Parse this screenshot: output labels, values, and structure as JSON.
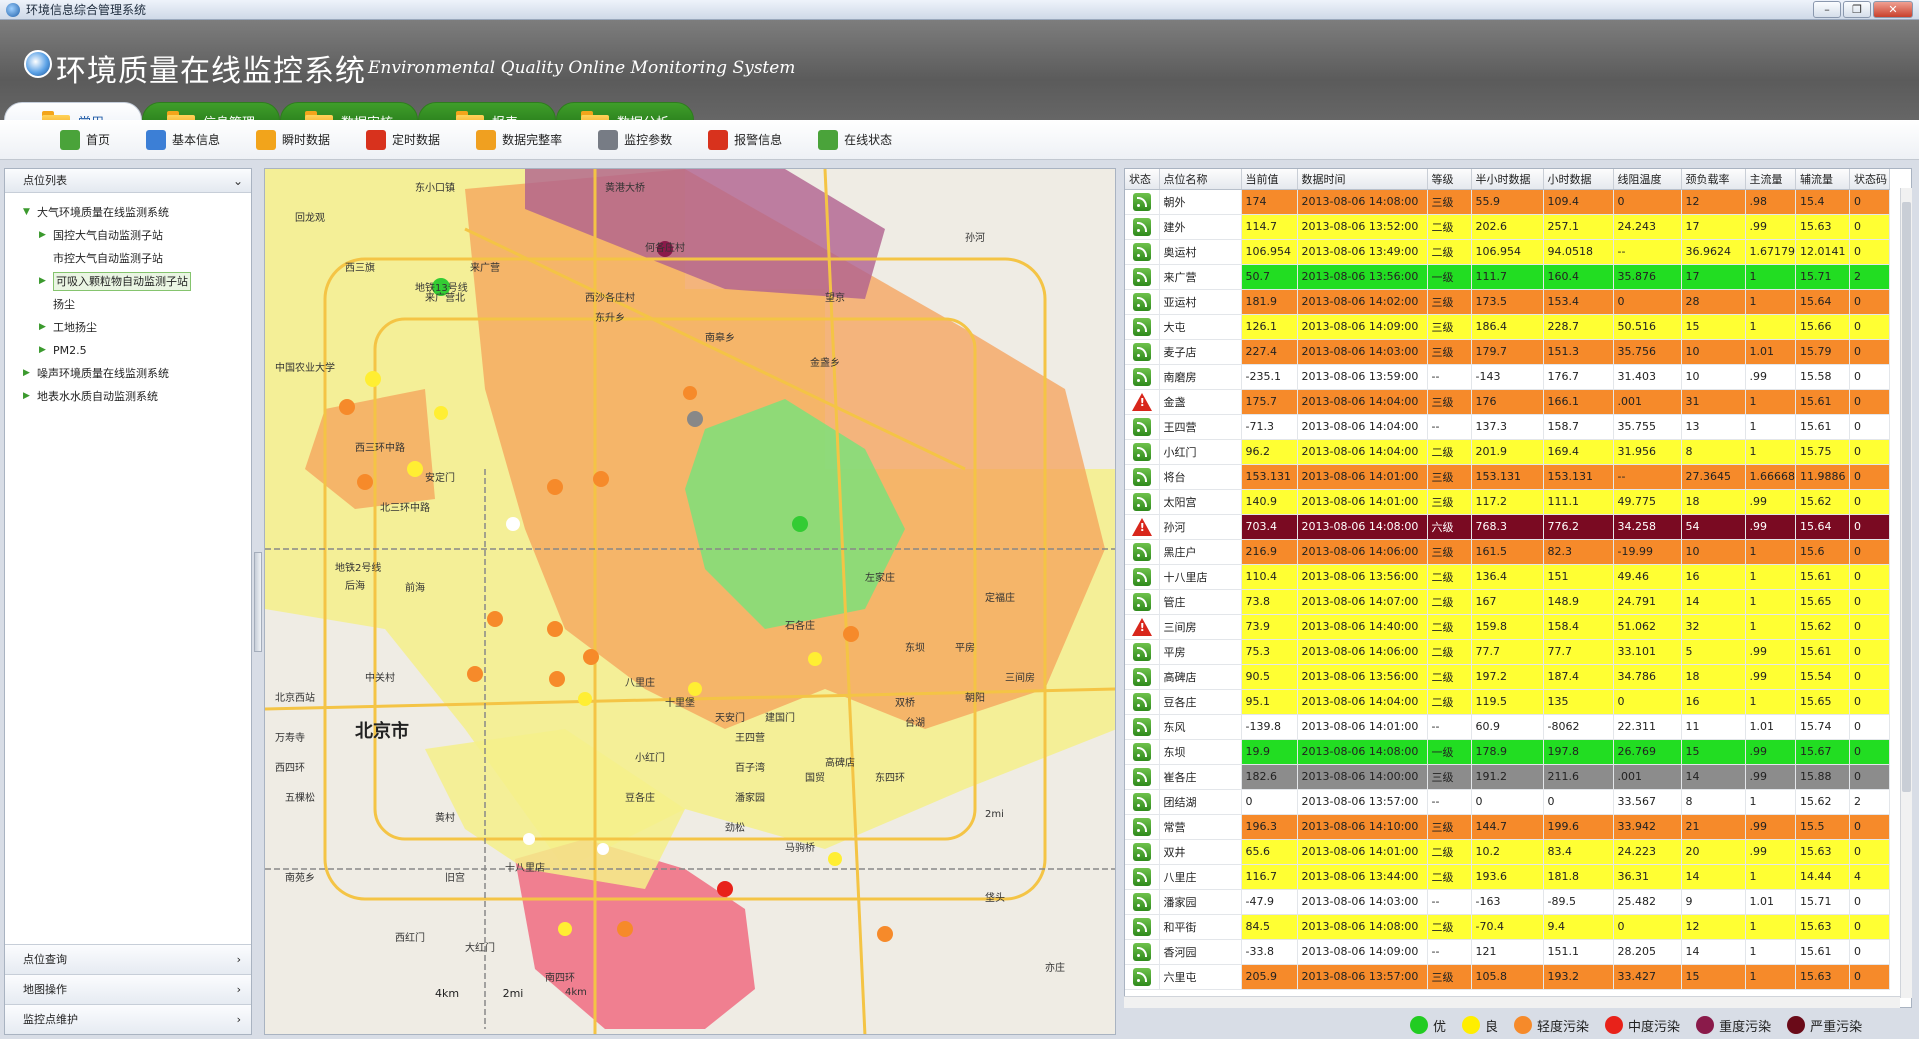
{
  "window": {
    "title": "环境信息综合管理系统",
    "buttons": [
      "–",
      "❐",
      "✕"
    ]
  },
  "header": {
    "title": "环境质量在线监控系统",
    "subtitle": "Environmental Quality Online Monitoring System"
  },
  "tabs": [
    {
      "label": "常用",
      "active": true
    },
    {
      "label": "信息管理"
    },
    {
      "label": "数据审核"
    },
    {
      "label": "报表"
    },
    {
      "label": "数据分析"
    }
  ],
  "toolbar": [
    {
      "label": "首页",
      "icon": "home-icon",
      "color": "#4aa33a"
    },
    {
      "label": "基本信息",
      "icon": "info-icon",
      "color": "#3c7fd6"
    },
    {
      "label": "瞬时数据",
      "icon": "lightning-icon",
      "color": "#f2a41b"
    },
    {
      "label": "定时数据",
      "icon": "clock-icon",
      "color": "#d8321d"
    },
    {
      "label": "数据完整率",
      "icon": "completeness-icon",
      "color": "#f0a020"
    },
    {
      "label": "监控参数",
      "icon": "params-icon",
      "color": "#777c85"
    },
    {
      "label": "报警信息",
      "icon": "phone-alarm-icon",
      "color": "#d8321d"
    },
    {
      "label": "在线状态",
      "icon": "speaker-icon",
      "color": "#4aa33a"
    }
  ],
  "left_panel": {
    "header": "点位列表",
    "tree": [
      {
        "label": "大气环境质量在线监测系统",
        "level": 0,
        "arrow": "▼"
      },
      {
        "label": "国控大气自动监测子站",
        "level": 1,
        "arrow": "▶"
      },
      {
        "label": "市控大气自动监测子站",
        "level": 1,
        "arrow": ""
      },
      {
        "label": "可吸入颗粒物自动监测子站",
        "level": 1,
        "arrow": "▶",
        "selected": true
      },
      {
        "label": "扬尘",
        "level": 1,
        "arrow": ""
      },
      {
        "label": "工地扬尘",
        "level": 1,
        "arrow": "▶"
      },
      {
        "label": "PM2.5",
        "level": 1,
        "arrow": "▶"
      },
      {
        "label": "噪声环境质量在线监测系统",
        "level": 0,
        "arrow": "▶"
      },
      {
        "label": "地表水水质自动监测系统",
        "level": 0,
        "arrow": "▶"
      }
    ],
    "bottom": [
      "点位查询",
      "地图操作",
      "监控点维护"
    ]
  },
  "map": {
    "city_label": "北京市",
    "labels": [
      "东小口镇",
      "黄港大桥",
      "西三旗",
      "回龙观",
      "何各庄村",
      "西沙各庄村",
      "来广营",
      "东升乡",
      "地铁13号线",
      "来广营北",
      "望京",
      "南皋乡",
      "金盏乡",
      "中国农业大学",
      "西三环中路",
      "北三环中路",
      "安定门",
      "地铁2号线",
      "后海",
      "前海",
      "北京西站",
      "万寿寺",
      "中关村",
      "孙河",
      "高碑店",
      "朝阳",
      "石各庄",
      "八里庄",
      "十里堡",
      "王四营",
      "百子湾",
      "潘家园",
      "劲松",
      "国贸",
      "东四环",
      "五棵松",
      "西四环",
      "建国门",
      "天安门",
      "左家庄",
      "东坝",
      "平房",
      "定福庄",
      "三间房",
      "双桥",
      "豆各庄",
      "小红门",
      "大红门",
      "南四环",
      "4km",
      "2mi",
      "亦庄",
      "台湖",
      "垡头",
      "马驹桥",
      "十八里店",
      "旧宫",
      "西红门",
      "黄村",
      "南苑乡"
    ],
    "scale": {
      "km": "4km",
      "mi": "2mi"
    }
  },
  "grid": {
    "columns": [
      "状态",
      "点位名称",
      "当前值",
      "数据时间",
      "等级",
      "半小时数据",
      "小时数据",
      "线阻温度",
      "颈负载率",
      "主流量",
      "辅流量",
      "状态码"
    ],
    "rows": [
      {
        "status": "ok",
        "name": "朝外",
        "cur": "174",
        "time": "2013-08-06 14:08:00",
        "lvl": "三级",
        "half": "55.9",
        "hour": "109.4",
        "temp": "0",
        "load": "12",
        "main": ".98",
        "aux": "15.4",
        "code": "0",
        "color": "#f68a2a"
      },
      {
        "status": "ok",
        "name": "建外",
        "cur": "114.7",
        "time": "2013-08-06 13:52:00",
        "lvl": "二级",
        "half": "202.6",
        "hour": "257.1",
        "temp": "24.243",
        "load": "17",
        "main": ".99",
        "aux": "15.63",
        "code": "0",
        "color": "#ffff33"
      },
      {
        "status": "ok",
        "name": "奥运村",
        "cur": "106.954",
        "time": "2013-08-06 13:49:00",
        "lvl": "二级",
        "half": "106.954",
        "hour": "94.0518",
        "temp": "--",
        "load": "36.9624",
        "main": "1.67179",
        "aux": "12.0141",
        "code": "0",
        "color": "#ffff33"
      },
      {
        "status": "ok",
        "name": "来广营",
        "cur": "50.7",
        "time": "2013-08-06 13:56:00",
        "lvl": "一级",
        "half": "111.7",
        "hour": "160.4",
        "temp": "35.876",
        "load": "17",
        "main": "1",
        "aux": "15.71",
        "code": "2",
        "color": "#22dd22"
      },
      {
        "status": "ok",
        "name": "亚运村",
        "cur": "181.9",
        "time": "2013-08-06 14:02:00",
        "lvl": "三级",
        "half": "173.5",
        "hour": "153.4",
        "temp": "0",
        "load": "28",
        "main": "1",
        "aux": "15.64",
        "code": "0",
        "color": "#f68a2a"
      },
      {
        "status": "ok",
        "name": "大屯",
        "cur": "126.1",
        "time": "2013-08-06 14:09:00",
        "lvl": "三级",
        "half": "186.4",
        "hour": "228.7",
        "temp": "50.516",
        "load": "15",
        "main": "1",
        "aux": "15.66",
        "code": "0",
        "color": "#ffff33"
      },
      {
        "status": "ok",
        "name": "麦子店",
        "cur": "227.4",
        "time": "2013-08-06 14:03:00",
        "lvl": "三级",
        "half": "179.7",
        "hour": "151.3",
        "temp": "35.756",
        "load": "10",
        "main": "1.01",
        "aux": "15.79",
        "code": "0",
        "color": "#f68a2a"
      },
      {
        "status": "ok",
        "name": "南磨房",
        "cur": "-235.1",
        "time": "2013-08-06 13:59:00",
        "lvl": "--",
        "half": "-143",
        "hour": "176.7",
        "temp": "31.403",
        "load": "10",
        "main": ".99",
        "aux": "15.58",
        "code": "0",
        "color": "#ffffff"
      },
      {
        "status": "warn",
        "name": "金盏",
        "cur": "175.7",
        "time": "2013-08-06 14:04:00",
        "lvl": "三级",
        "half": "176",
        "hour": "166.1",
        "temp": ".001",
        "load": "31",
        "main": "1",
        "aux": "15.61",
        "code": "0",
        "color": "#f68a2a"
      },
      {
        "status": "ok",
        "name": "王四营",
        "cur": "-71.3",
        "time": "2013-08-06 14:04:00",
        "lvl": "--",
        "half": "137.3",
        "hour": "158.7",
        "temp": "35.755",
        "load": "13",
        "main": "1",
        "aux": "15.61",
        "code": "0",
        "color": "#ffffff"
      },
      {
        "status": "ok",
        "name": "小红门",
        "cur": "96.2",
        "time": "2013-08-06 14:04:00",
        "lvl": "二级",
        "half": "201.9",
        "hour": "169.4",
        "temp": "31.956",
        "load": "8",
        "main": "1",
        "aux": "15.75",
        "code": "0",
        "color": "#ffff33"
      },
      {
        "status": "ok",
        "name": "将台",
        "cur": "153.131",
        "time": "2013-08-06 14:01:00",
        "lvl": "三级",
        "half": "153.131",
        "hour": "153.131",
        "temp": "--",
        "load": "27.3645",
        "main": "1.66668",
        "aux": "11.9886",
        "code": "0",
        "color": "#f68a2a"
      },
      {
        "status": "ok",
        "name": "太阳宫",
        "cur": "140.9",
        "time": "2013-08-06 14:01:00",
        "lvl": "三级",
        "half": "117.2",
        "hour": "111.1",
        "temp": "49.775",
        "load": "18",
        "main": ".99",
        "aux": "15.62",
        "code": "0",
        "color": "#ffff33"
      },
      {
        "status": "warn",
        "name": "孙河",
        "cur": "703.4",
        "time": "2013-08-06 14:08:00",
        "lvl": "六级",
        "half": "768.3",
        "hour": "776.2",
        "temp": "34.258",
        "load": "54",
        "main": ".99",
        "aux": "15.64",
        "code": "0",
        "color": "#7a0a22"
      },
      {
        "status": "ok",
        "name": "黑庄户",
        "cur": "216.9",
        "time": "2013-08-06 14:06:00",
        "lvl": "三级",
        "half": "161.5",
        "hour": "82.3",
        "temp": "-19.99",
        "load": "10",
        "main": "1",
        "aux": "15.6",
        "code": "0",
        "color": "#f68a2a"
      },
      {
        "status": "ok",
        "name": "十八里店",
        "cur": "110.4",
        "time": "2013-08-06 13:56:00",
        "lvl": "二级",
        "half": "136.4",
        "hour": "151",
        "temp": "49.46",
        "load": "16",
        "main": "1",
        "aux": "15.61",
        "code": "0",
        "color": "#ffff33"
      },
      {
        "status": "ok",
        "name": "管庄",
        "cur": "73.8",
        "time": "2013-08-06 14:07:00",
        "lvl": "二级",
        "half": "167",
        "hour": "148.9",
        "temp": "24.791",
        "load": "14",
        "main": "1",
        "aux": "15.65",
        "code": "0",
        "color": "#ffff33"
      },
      {
        "status": "warn",
        "name": "三间房",
        "cur": "73.9",
        "time": "2013-08-06 14:40:00",
        "lvl": "二级",
        "half": "159.8",
        "hour": "158.4",
        "temp": "51.062",
        "load": "32",
        "main": "1",
        "aux": "15.62",
        "code": "0",
        "color": "#ffff33"
      },
      {
        "status": "ok",
        "name": "平房",
        "cur": "75.3",
        "time": "2013-08-06 14:06:00",
        "lvl": "二级",
        "half": "77.7",
        "hour": "77.7",
        "temp": "33.101",
        "load": "5",
        "main": ".99",
        "aux": "15.61",
        "code": "0",
        "color": "#ffff33"
      },
      {
        "status": "ok",
        "name": "高碑店",
        "cur": "90.5",
        "time": "2013-08-06 13:56:00",
        "lvl": "二级",
        "half": "197.2",
        "hour": "187.4",
        "temp": "34.786",
        "load": "18",
        "main": ".99",
        "aux": "15.54",
        "code": "0",
        "color": "#ffff33"
      },
      {
        "status": "ok",
        "name": "豆各庄",
        "cur": "95.1",
        "time": "2013-08-06 14:04:00",
        "lvl": "二级",
        "half": "119.5",
        "hour": "135",
        "temp": "0",
        "load": "16",
        "main": "1",
        "aux": "15.65",
        "code": "0",
        "color": "#ffff33"
      },
      {
        "status": "ok",
        "name": "东风",
        "cur": "-139.8",
        "time": "2013-08-06 14:01:00",
        "lvl": "--",
        "half": "60.9",
        "hour": "-8062",
        "temp": "22.311",
        "load": "11",
        "main": "1.01",
        "aux": "15.74",
        "code": "0",
        "color": "#ffffff"
      },
      {
        "status": "ok",
        "name": "东坝",
        "cur": "19.9",
        "time": "2013-08-06 14:08:00",
        "lvl": "一级",
        "half": "178.9",
        "hour": "197.8",
        "temp": "26.769",
        "load": "15",
        "main": ".99",
        "aux": "15.67",
        "code": "0",
        "color": "#22dd22"
      },
      {
        "status": "ok",
        "name": "崔各庄",
        "cur": "182.6",
        "time": "2013-08-06 14:00:00",
        "lvl": "三级",
        "half": "191.2",
        "hour": "211.6",
        "temp": ".001",
        "load": "14",
        "main": ".99",
        "aux": "15.88",
        "code": "0",
        "color": "#8c8c8c"
      },
      {
        "status": "ok",
        "name": "团结湖",
        "cur": "0",
        "time": "2013-08-06 13:57:00",
        "lvl": "--",
        "half": "0",
        "hour": "0",
        "temp": "33.567",
        "load": "8",
        "main": "1",
        "aux": "15.62",
        "code": "2",
        "color": "#ffffff"
      },
      {
        "status": "ok",
        "name": "常营",
        "cur": "196.3",
        "time": "2013-08-06 14:10:00",
        "lvl": "三级",
        "half": "144.7",
        "hour": "199.6",
        "temp": "33.942",
        "load": "21",
        "main": ".99",
        "aux": "15.5",
        "code": "0",
        "color": "#f68a2a"
      },
      {
        "status": "ok",
        "name": "双井",
        "cur": "65.6",
        "time": "2013-08-06 14:01:00",
        "lvl": "二级",
        "half": "10.2",
        "hour": "83.4",
        "temp": "24.223",
        "load": "20",
        "main": ".99",
        "aux": "15.63",
        "code": "0",
        "color": "#ffff33"
      },
      {
        "status": "ok",
        "name": "八里庄",
        "cur": "116.7",
        "time": "2013-08-06 13:44:00",
        "lvl": "二级",
        "half": "193.6",
        "hour": "181.8",
        "temp": "36.31",
        "load": "14",
        "main": "1",
        "aux": "14.44",
        "code": "4",
        "color": "#ffff33"
      },
      {
        "status": "ok",
        "name": "潘家园",
        "cur": "-47.9",
        "time": "2013-08-06 14:03:00",
        "lvl": "--",
        "half": "-163",
        "hour": "-89.5",
        "temp": "25.482",
        "load": "9",
        "main": "1.01",
        "aux": "15.71",
        "code": "0",
        "color": "#ffffff"
      },
      {
        "status": "ok",
        "name": "和平街",
        "cur": "84.5",
        "time": "2013-08-06 14:08:00",
        "lvl": "二级",
        "half": "-70.4",
        "hour": "9.4",
        "temp": "0",
        "load": "12",
        "main": "1",
        "aux": "15.63",
        "code": "0",
        "color": "#ffff33"
      },
      {
        "status": "ok",
        "name": "香河园",
        "cur": "-33.8",
        "time": "2013-08-06 14:09:00",
        "lvl": "--",
        "half": "121",
        "hour": "151.1",
        "temp": "28.205",
        "load": "14",
        "main": "1",
        "aux": "15.61",
        "code": "0",
        "color": "#ffffff"
      },
      {
        "status": "ok",
        "name": "六里屯",
        "cur": "205.9",
        "time": "2013-08-06 13:57:00",
        "lvl": "三级",
        "half": "105.8",
        "hour": "193.2",
        "temp": "33.427",
        "load": "15",
        "main": "1",
        "aux": "15.63",
        "code": "0",
        "color": "#f68a2a"
      }
    ]
  },
  "legend": [
    {
      "label": "优",
      "color": "#22cc22"
    },
    {
      "label": "良",
      "color": "#ffee00"
    },
    {
      "label": "轻度污染",
      "color": "#f68a2a"
    },
    {
      "label": "中度污染",
      "color": "#e8221a"
    },
    {
      "label": "重度污染",
      "color": "#8a1a4a"
    },
    {
      "label": "严重污染",
      "color": "#6a0a18"
    }
  ]
}
